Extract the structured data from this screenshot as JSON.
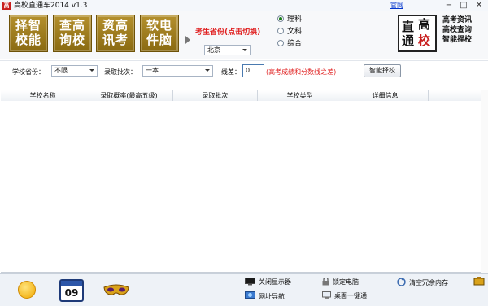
{
  "window": {
    "title": "高校直通车2014 v1.3",
    "home_link": "官网",
    "controls": [
      "minimize-icon",
      "maximize-icon",
      "close-icon"
    ]
  },
  "header": {
    "tiles": [
      {
        "line1": "择智",
        "line2": "校能"
      },
      {
        "line1": "查高",
        "line2": "询校"
      },
      {
        "line1": "资高",
        "line2": "讯考"
      },
      {
        "line1": "软电",
        "line2": "件脑"
      }
    ],
    "province_title": "考生省份(点击切换)",
    "province_value": "北京",
    "subjects": [
      {
        "label": "理科",
        "selected": true
      },
      {
        "label": "文科",
        "selected": false
      },
      {
        "label": "综合",
        "selected": false
      }
    ],
    "logo_chars": [
      "直",
      "高",
      "通",
      "校"
    ],
    "features": [
      "高考资讯",
      "高校查询",
      "智能择校"
    ]
  },
  "filters": {
    "school_province_label": "学校省份：",
    "school_province_value": "不限",
    "batch_label": "录取批次：",
    "batch_value": "一本",
    "score_label": "线差：",
    "score_value": "0",
    "score_hint": "(高考成绩和分数线之差)",
    "smart_button": "智能择校"
  },
  "table": {
    "columns": [
      "学校名称",
      "录取概率(最高五级)",
      "录取批次",
      "学校类型",
      "详细信息"
    ],
    "rows": []
  },
  "footer": {
    "calendar_day": "09",
    "tools": [
      {
        "label": "关闭显示器",
        "icon": "monitor-icon"
      },
      {
        "label": "锁定电脑",
        "icon": "lock-icon"
      },
      {
        "label": "清空冗余内存",
        "icon": "memory-clean-icon"
      },
      {
        "label": "网址导航",
        "icon": "web-nav-icon"
      },
      {
        "label": "桌面一键通",
        "icon": "desktop-icon"
      }
    ]
  },
  "colors": {
    "accent_red": "#e02020",
    "tile_gold": "#b4902d",
    "logo_red": "#c81e1e",
    "calendar_blue": "#2c56a8"
  }
}
